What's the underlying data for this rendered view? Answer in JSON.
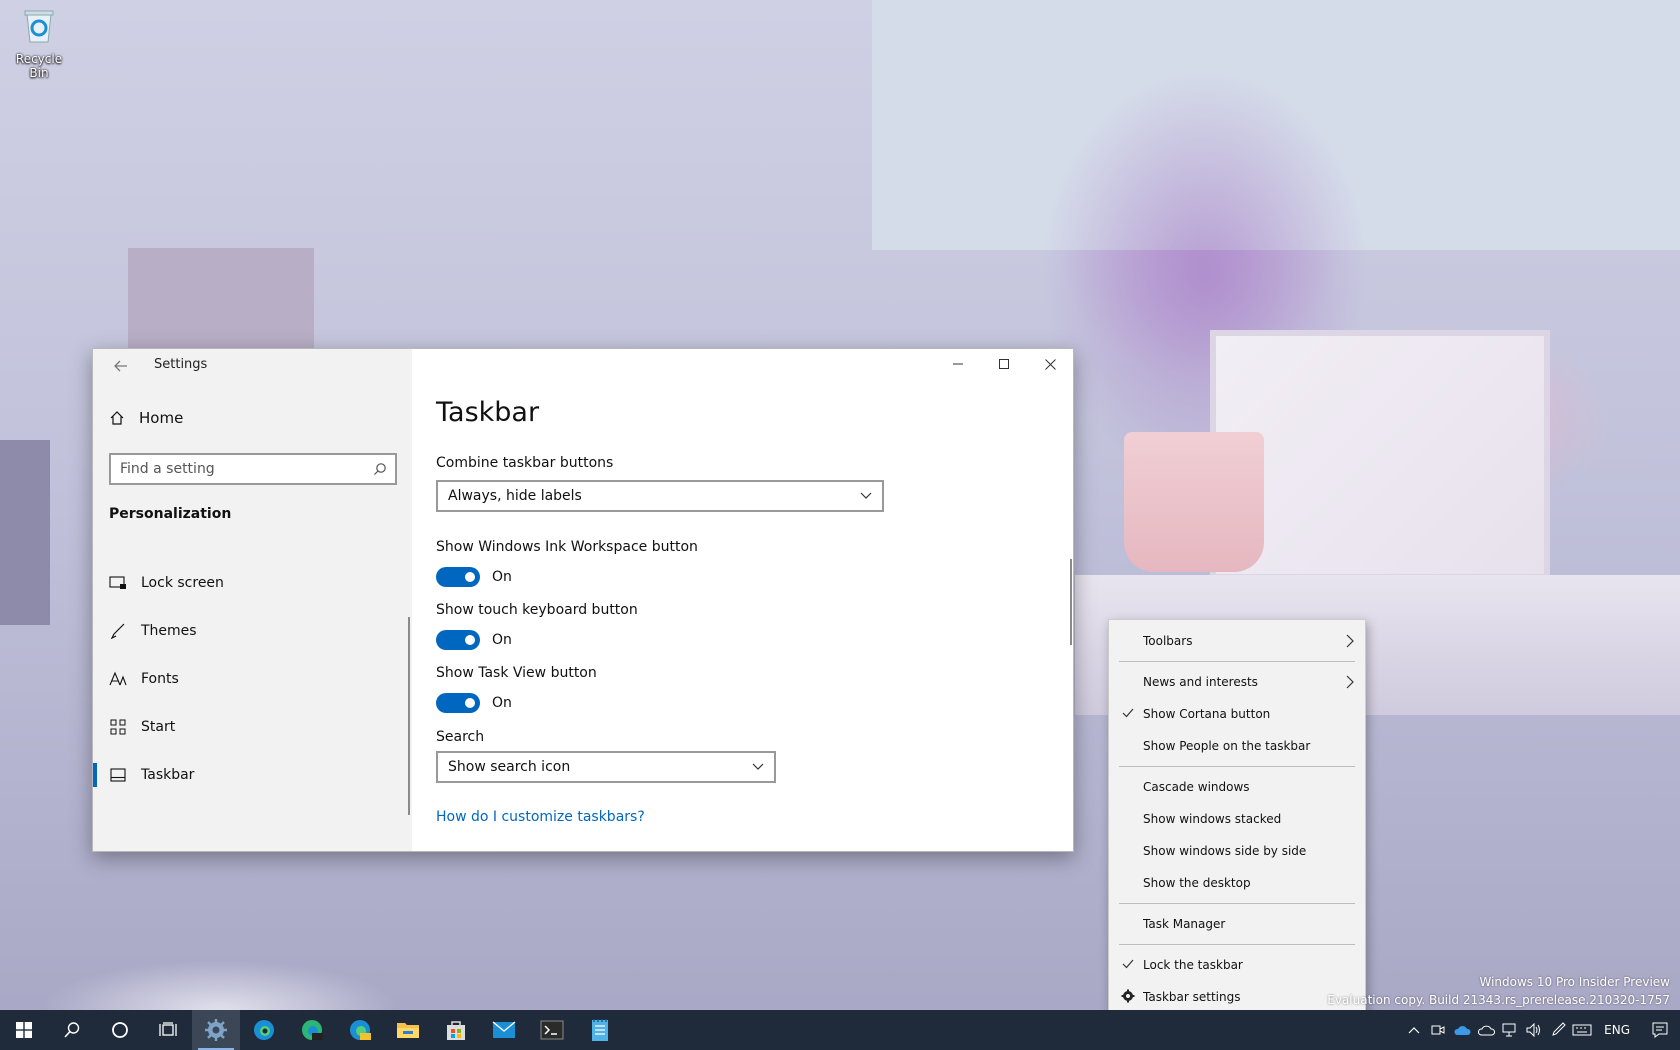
{
  "desktop": {
    "recycle_bin_label": "Recycle Bin",
    "watermark_line1": "Windows 10 Pro Insider Preview",
    "watermark_line2": "Evaluation copy. Build 21343.rs_prerelease.210320-1757"
  },
  "settings": {
    "title": "Settings",
    "nav": {
      "home_label": "Home",
      "search_placeholder": "Find a setting",
      "section": "Personalization",
      "items": [
        {
          "label": "Lock screen",
          "icon": "lock-screen-icon"
        },
        {
          "label": "Themes",
          "icon": "brush-icon"
        },
        {
          "label": "Fonts",
          "icon": "font-icon"
        },
        {
          "label": "Start",
          "icon": "start-grid-icon"
        },
        {
          "label": "Taskbar",
          "icon": "taskbar-icon",
          "active": true
        }
      ]
    },
    "content": {
      "page_title": "Taskbar",
      "combine_label": "Combine taskbar buttons",
      "combine_value": "Always, hide labels",
      "ink_label": "Show Windows Ink Workspace button",
      "ink_state": "On",
      "touch_label": "Show touch keyboard button",
      "touch_state": "On",
      "taskview_label": "Show Task View button",
      "taskview_state": "On",
      "search_label": "Search",
      "search_value": "Show search icon",
      "help_link": "How do I customize taskbars?"
    },
    "accent_color": "#0067c0"
  },
  "context_menu": {
    "toolbars": "Toolbars",
    "news": "News and interests",
    "cortana": "Show Cortana button",
    "people": "Show People on the taskbar",
    "cascade": "Cascade windows",
    "stacked": "Show windows stacked",
    "side_by_side": "Show windows side by side",
    "desktop": "Show the desktop",
    "task_manager": "Task Manager",
    "lock": "Lock the taskbar",
    "taskbar_settings": "Taskbar settings"
  },
  "taskbar": {
    "language": "ENG",
    "background": "#1f2b3a"
  }
}
